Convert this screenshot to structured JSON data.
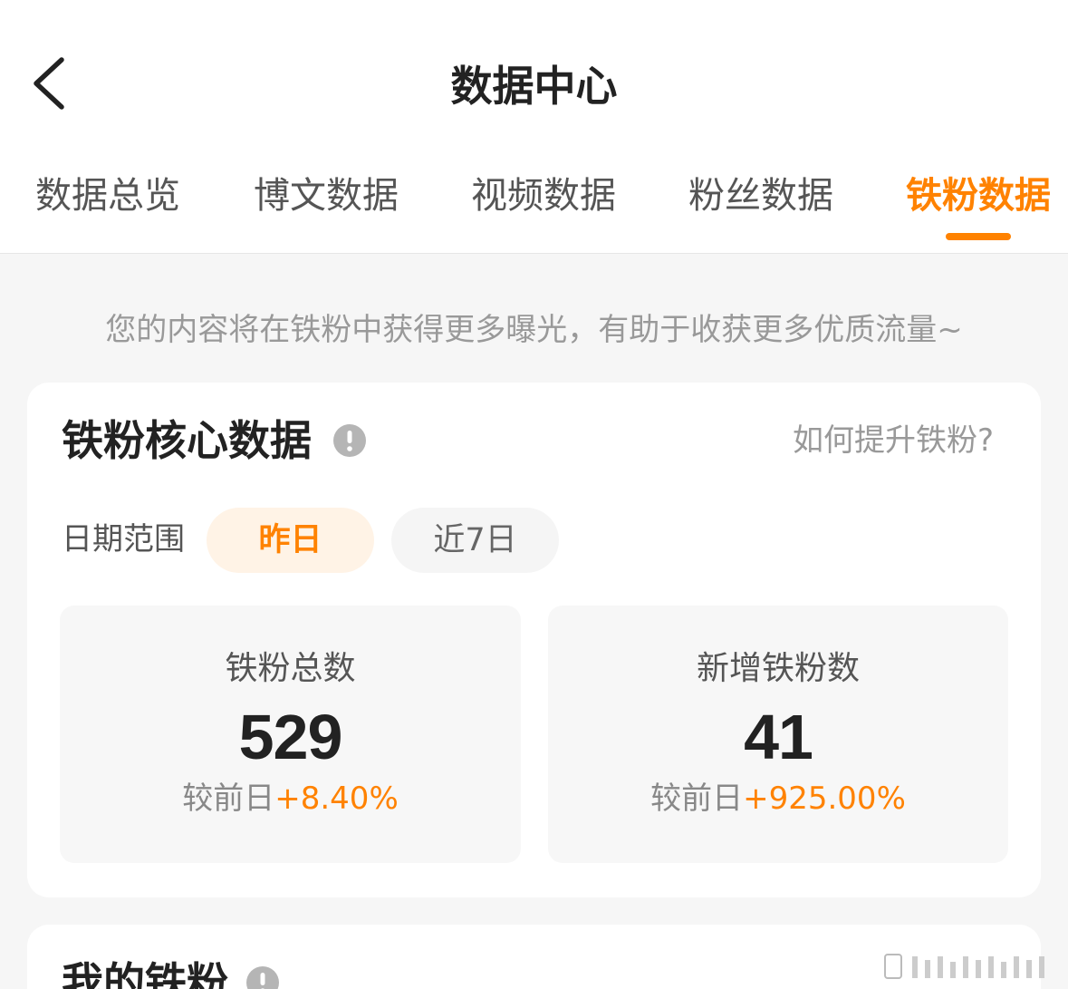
{
  "header": {
    "title": "数据中心"
  },
  "tabs": [
    {
      "label": "数据总览"
    },
    {
      "label": "博文数据"
    },
    {
      "label": "视频数据"
    },
    {
      "label": "粉丝数据"
    },
    {
      "label": "铁粉数据",
      "active": true
    }
  ],
  "notice": "您的内容将在铁粉中获得更多曝光，有助于收获更多优质流量~",
  "core_card": {
    "title": "铁粉核心数据",
    "help_link": "如何提升铁粉?",
    "date_range": {
      "label": "日期范围",
      "options": [
        "昨日",
        "近7日"
      ],
      "selected": "昨日"
    },
    "stats": [
      {
        "label": "铁粉总数",
        "value": "529",
        "compare_label": "较前日",
        "compare_value": "+8.40%"
      },
      {
        "label": "新增铁粉数",
        "value": "41",
        "compare_label": "较前日",
        "compare_value": "+925.00%"
      }
    ]
  },
  "my_fans_card": {
    "title": "我的铁粉"
  },
  "colors": {
    "accent": "#ff8200",
    "accent_bg": "#fff3e6",
    "background": "#f6f6f6",
    "card": "#ffffff"
  },
  "icons": {
    "back": "chevron-left-icon",
    "info": "info-icon",
    "watermark": "watermark-icon"
  }
}
